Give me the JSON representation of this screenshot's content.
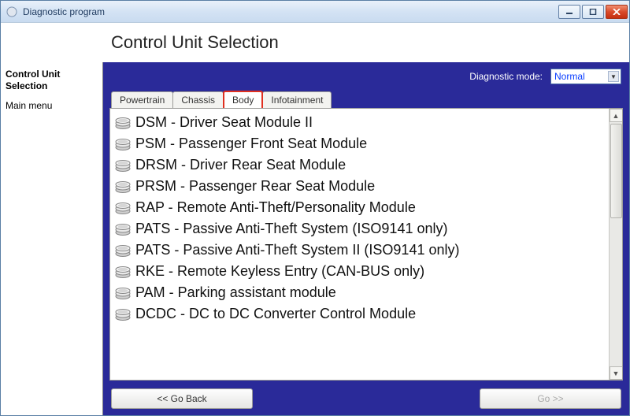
{
  "window": {
    "title": "Diagnostic program"
  },
  "header": {
    "title": "Control Unit Selection"
  },
  "sidebar": {
    "items": [
      {
        "label": "Control Unit Selection",
        "active": true
      },
      {
        "label": "Main menu",
        "active": false
      }
    ]
  },
  "mode": {
    "label": "Diagnostic mode:",
    "selected": "Normal"
  },
  "tabs": [
    {
      "label": "Powertrain",
      "active": false
    },
    {
      "label": "Chassis",
      "active": false
    },
    {
      "label": "Body",
      "active": true
    },
    {
      "label": "Infotainment",
      "active": false
    }
  ],
  "modules": [
    {
      "label": "DSM - Driver Seat Module II"
    },
    {
      "label": "PSM - Passenger Front Seat Module"
    },
    {
      "label": "DRSM - Driver Rear Seat Module"
    },
    {
      "label": "PRSM - Passenger Rear Seat Module"
    },
    {
      "label": "RAP - Remote Anti-Theft/Personality Module"
    },
    {
      "label": "PATS - Passive Anti-Theft System (ISO9141 only)"
    },
    {
      "label": "PATS - Passive Anti-Theft System II (ISO9141 only)"
    },
    {
      "label": "RKE - Remote Keyless Entry (CAN-BUS only)"
    },
    {
      "label": "PAM - Parking assistant module"
    },
    {
      "label": "DCDC - DC to DC Converter Control Module"
    }
  ],
  "footer": {
    "back": "<< Go Back",
    "go": "Go >>"
  }
}
